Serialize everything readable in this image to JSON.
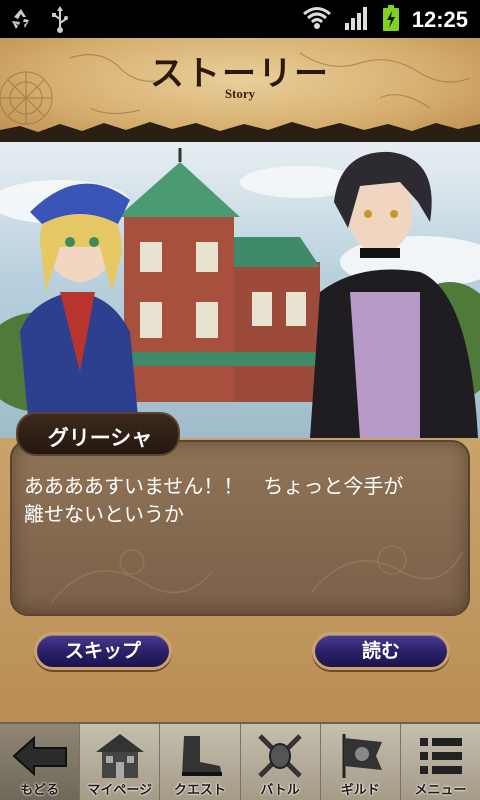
{
  "status_bar": {
    "time": "12:25",
    "icons": [
      "recycle-icon",
      "usb-icon",
      "wifi-icon",
      "signal-icon",
      "battery-charging-icon"
    ],
    "battery_color": "#7ed321"
  },
  "header": {
    "title": "ストーリー",
    "subtitle": "Story"
  },
  "dialogue": {
    "speaker": "グリーシャ",
    "text": "ああああすいません！！　ちょっと今手が\n離せないというか"
  },
  "actions": {
    "skip_label": "スキップ",
    "read_label": "読む"
  },
  "bottom_nav": {
    "items": [
      {
        "label": "もどる",
        "icon": "back-arrow-icon"
      },
      {
        "label": "マイページ",
        "icon": "house-icon"
      },
      {
        "label": "クエスト",
        "icon": "boots-icon"
      },
      {
        "label": "バトル",
        "icon": "crossed-swords-icon"
      },
      {
        "label": "ギルド",
        "icon": "guild-flag-icon"
      },
      {
        "label": "メニュー",
        "icon": "menu-list-icon"
      }
    ]
  },
  "colors": {
    "button_fill": "#2a1f66",
    "button_border": "#caa36a",
    "dialog_box": "#7a6049",
    "name_tag": "#241710"
  }
}
